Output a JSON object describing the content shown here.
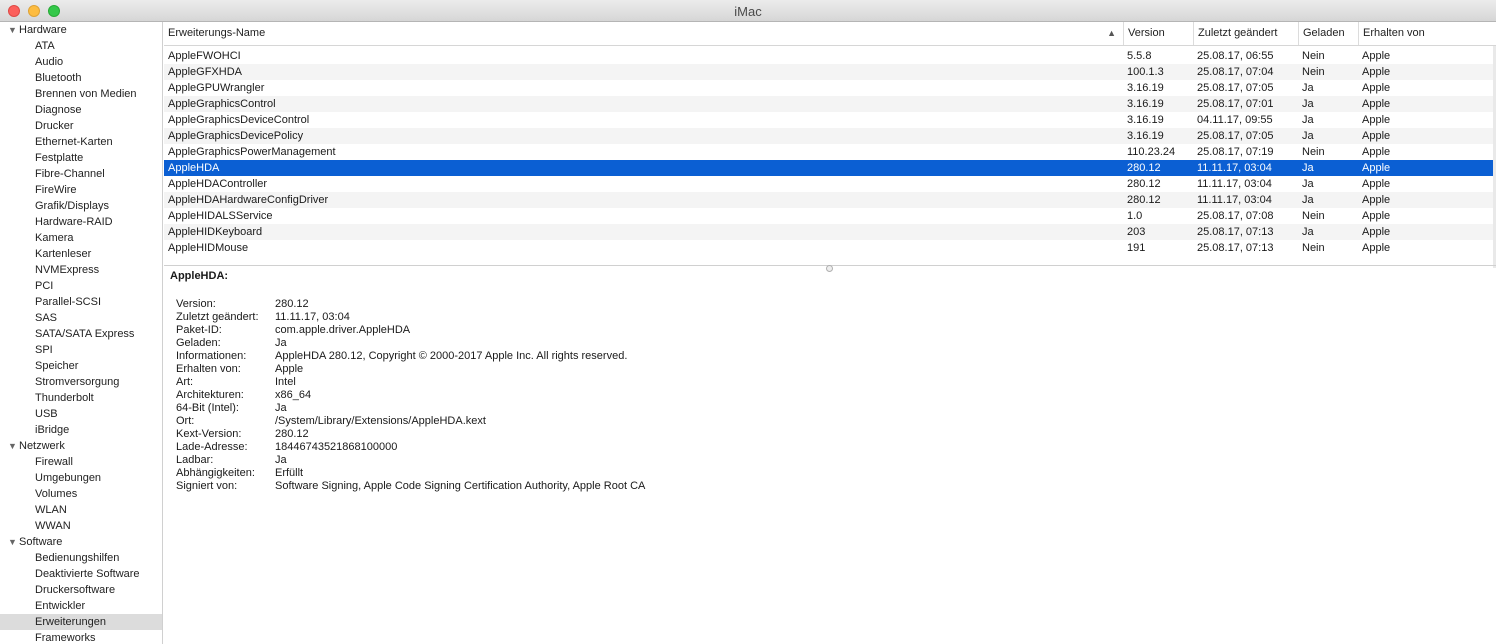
{
  "window": {
    "title": "iMac"
  },
  "sidebar": [
    {
      "label": "Hardware",
      "type": "category"
    },
    {
      "label": "ATA"
    },
    {
      "label": "Audio"
    },
    {
      "label": "Bluetooth"
    },
    {
      "label": "Brennen von Medien"
    },
    {
      "label": "Diagnose"
    },
    {
      "label": "Drucker"
    },
    {
      "label": "Ethernet-Karten"
    },
    {
      "label": "Festplatte"
    },
    {
      "label": "Fibre-Channel"
    },
    {
      "label": "FireWire"
    },
    {
      "label": "Grafik/Displays"
    },
    {
      "label": "Hardware-RAID"
    },
    {
      "label": "Kamera"
    },
    {
      "label": "Kartenleser"
    },
    {
      "label": "NVMExpress"
    },
    {
      "label": "PCI"
    },
    {
      "label": "Parallel-SCSI"
    },
    {
      "label": "SAS"
    },
    {
      "label": "SATA/SATA Express"
    },
    {
      "label": "SPI"
    },
    {
      "label": "Speicher"
    },
    {
      "label": "Stromversorgung"
    },
    {
      "label": "Thunderbolt"
    },
    {
      "label": "USB"
    },
    {
      "label": "iBridge"
    },
    {
      "label": "Netzwerk",
      "type": "category"
    },
    {
      "label": "Firewall"
    },
    {
      "label": "Umgebungen"
    },
    {
      "label": "Volumes"
    },
    {
      "label": "WLAN"
    },
    {
      "label": "WWAN"
    },
    {
      "label": "Software",
      "type": "category"
    },
    {
      "label": "Bedienungshilfen"
    },
    {
      "label": "Deaktivierte Software"
    },
    {
      "label": "Druckersoftware"
    },
    {
      "label": "Entwickler"
    },
    {
      "label": "Erweiterungen",
      "selected": true
    },
    {
      "label": "Frameworks"
    }
  ],
  "table": {
    "columns": [
      "Erweiterungs-Name",
      "Version",
      "Zuletzt geändert",
      "Geladen",
      "Erhalten von"
    ],
    "sort_indicator": "▲",
    "rows": [
      [
        "AppleFWOHCI",
        "5.5.8",
        "25.08.17, 06:55",
        "Nein",
        "Apple"
      ],
      [
        "AppleGFXHDA",
        "100.1.3",
        "25.08.17, 07:04",
        "Nein",
        "Apple"
      ],
      [
        "AppleGPUWrangler",
        "3.16.19",
        "25.08.17, 07:05",
        "Ja",
        "Apple"
      ],
      [
        "AppleGraphicsControl",
        "3.16.19",
        "25.08.17, 07:01",
        "Ja",
        "Apple"
      ],
      [
        "AppleGraphicsDeviceControl",
        "3.16.19",
        "04.11.17, 09:55",
        "Ja",
        "Apple"
      ],
      [
        "AppleGraphicsDevicePolicy",
        "3.16.19",
        "25.08.17, 07:05",
        "Ja",
        "Apple"
      ],
      [
        "AppleGraphicsPowerManagement",
        "110.23.24",
        "25.08.17, 07:19",
        "Nein",
        "Apple"
      ],
      [
        "AppleHDA",
        "280.12",
        "11.11.17, 03:04",
        "Ja",
        "Apple"
      ],
      [
        "AppleHDAController",
        "280.12",
        "11.11.17, 03:04",
        "Ja",
        "Apple"
      ],
      [
        "AppleHDAHardwareConfigDriver",
        "280.12",
        "11.11.17, 03:04",
        "Ja",
        "Apple"
      ],
      [
        "AppleHIDALSService",
        "1.0",
        "25.08.17, 07:08",
        "Nein",
        "Apple"
      ],
      [
        "AppleHIDKeyboard",
        "203",
        "25.08.17, 07:13",
        "Ja",
        "Apple"
      ],
      [
        "AppleHIDMouse",
        "191",
        "25.08.17, 07:13",
        "Nein",
        "Apple"
      ]
    ],
    "selected_row": 7
  },
  "detail": {
    "title": "AppleHDA:",
    "fields": [
      {
        "key": "Version:",
        "value": "280.12"
      },
      {
        "key": "Zuletzt geändert:",
        "value": "11.11.17, 03:04"
      },
      {
        "key": "Paket-ID:",
        "value": "com.apple.driver.AppleHDA"
      },
      {
        "key": "Geladen:",
        "value": "Ja"
      },
      {
        "key": "Informationen:",
        "value": "AppleHDA 280.12, Copyright © 2000-2017 Apple Inc. All rights reserved."
      },
      {
        "key": "Erhalten von:",
        "value": "Apple"
      },
      {
        "key": "Art:",
        "value": "Intel"
      },
      {
        "key": "Architekturen:",
        "value": "x86_64"
      },
      {
        "key": "64-Bit (Intel):",
        "value": "Ja"
      },
      {
        "key": "Ort:",
        "value": "/System/Library/Extensions/AppleHDA.kext"
      },
      {
        "key": "Kext-Version:",
        "value": "280.12"
      },
      {
        "key": "Lade-Adresse:",
        "value": "18446743521868100000"
      },
      {
        "key": "Ladbar:",
        "value": "Ja"
      },
      {
        "key": "Abhängigkeiten:",
        "value": "Erfüllt"
      },
      {
        "key": "Signiert von:",
        "value": "Software Signing, Apple Code Signing Certification Authority, Apple Root CA"
      }
    ]
  }
}
